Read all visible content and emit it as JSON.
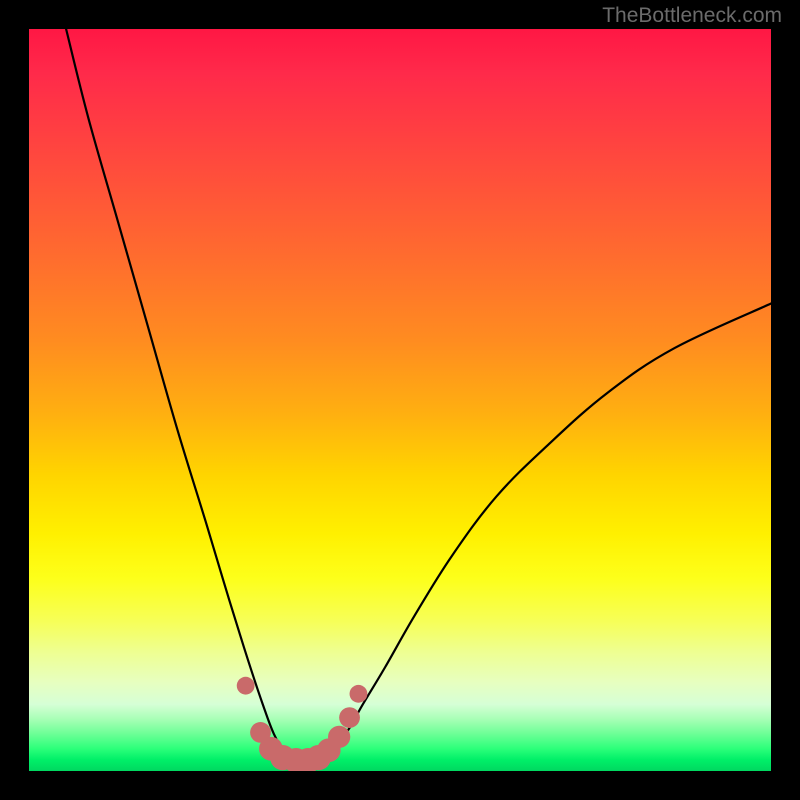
{
  "watermark": "TheBottleneck.com",
  "chart_data": {
    "type": "line",
    "title": "",
    "xlabel": "",
    "ylabel": "",
    "xlim": [
      0,
      100
    ],
    "ylim": [
      0,
      100
    ],
    "series": [
      {
        "name": "bottleneck-curve",
        "x": [
          5,
          8,
          12,
          16,
          20,
          24,
          27,
          29.5,
          31.5,
          33,
          34.5,
          36,
          37.5,
          39,
          41,
          43,
          45,
          48,
          52,
          57,
          63,
          70,
          78,
          87,
          100
        ],
        "y": [
          100,
          88,
          74,
          60,
          46,
          33,
          23,
          15,
          9,
          5,
          2.5,
          1.5,
          1.5,
          1.8,
          3,
          5.5,
          9,
          14,
          21,
          29,
          37,
          44,
          51,
          57,
          63
        ]
      }
    ],
    "markers": {
      "name": "bottom-dots",
      "color": "#c96a6a",
      "points": [
        {
          "x": 29.2,
          "y": 11.5,
          "r": 1.2
        },
        {
          "x": 31.2,
          "y": 5.2,
          "r": 1.4
        },
        {
          "x": 32.6,
          "y": 3.0,
          "r": 1.6
        },
        {
          "x": 34.2,
          "y": 1.8,
          "r": 1.7
        },
        {
          "x": 36.0,
          "y": 1.4,
          "r": 1.7
        },
        {
          "x": 37.6,
          "y": 1.4,
          "r": 1.7
        },
        {
          "x": 39.0,
          "y": 1.8,
          "r": 1.7
        },
        {
          "x": 40.4,
          "y": 2.8,
          "r": 1.6
        },
        {
          "x": 41.8,
          "y": 4.6,
          "r": 1.5
        },
        {
          "x": 43.2,
          "y": 7.2,
          "r": 1.4
        },
        {
          "x": 44.4,
          "y": 10.4,
          "r": 1.2
        }
      ]
    },
    "background_gradient": {
      "top_color": "#ff1744",
      "bottom_color": "#00d860"
    }
  }
}
